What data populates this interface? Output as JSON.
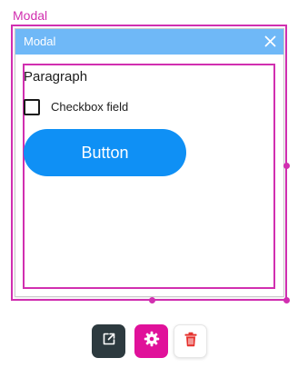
{
  "selection": {
    "label": "Modal"
  },
  "modal": {
    "title": "Modal",
    "close_icon": "close-icon",
    "paragraph": "Paragraph",
    "checkbox": {
      "label": "Checkbox field",
      "checked": false
    },
    "button_label": "Button"
  },
  "toolbar": {
    "items": [
      {
        "name": "open-external",
        "icon": "open-external-icon"
      },
      {
        "name": "settings",
        "icon": "gear-icon"
      },
      {
        "name": "delete",
        "icon": "trash-icon"
      }
    ]
  },
  "colors": {
    "selection_accent": "#d12fb0",
    "modal_header": "#6fb8f7",
    "button_primary": "#0f90f5",
    "toolbar_dark": "#2d3a3f",
    "toolbar_settings": "#e0119a",
    "delete_red": "#e5302c"
  }
}
